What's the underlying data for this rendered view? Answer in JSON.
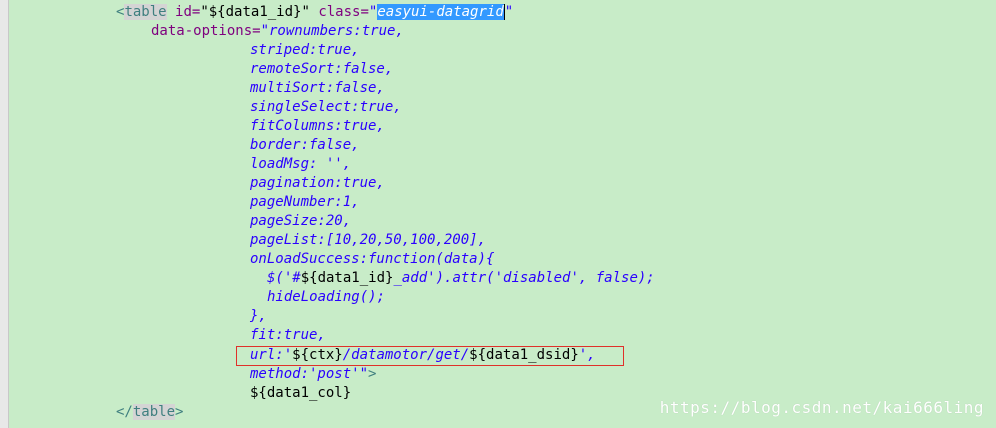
{
  "editor": {
    "line1": {
      "open": "<",
      "tag": "table",
      "attr1": " id=",
      "val1": "\"${data1_id}\"",
      "attr2": " class=",
      "quote_open": "\"",
      "selected": "easyui-datagrid",
      "quote_close": "\""
    },
    "line2": {
      "attr": "data-options=",
      "val": "\"rownumbers:true,"
    },
    "options": [
      "striped:true,",
      "remoteSort:false,",
      "multiSort:false,",
      "singleSelect:true,",
      "fitColumns:true,",
      "border:false,",
      "loadMsg: '',",
      "pagination:true,",
      "pageNumber:1,",
      "pageSize:20,",
      "pageList:[10,20,50,100,200],",
      "onLoadSuccess:function(data){"
    ],
    "inner": {
      "l1a": "$('#",
      "l1b": "${data1_id}",
      "l1c": "_add').attr('disabled', false);",
      "l2": "hideLoading();"
    },
    "close_brace": "},",
    "fit": "fit:true,",
    "url": {
      "a": "url:'",
      "b": "${ctx}",
      "c": "/datamotor/get/",
      "d": "${data1_dsid}",
      "e": "',"
    },
    "method": {
      "a": "method:'post'",
      "b": "\"",
      "c": ">"
    },
    "col": "${data1_col}",
    "closing": {
      "open": "</",
      "tag": "table",
      "close": ">"
    }
  },
  "watermark": "https://blog.csdn.net/kai666ling",
  "colors": {
    "background": "#c8ecc8",
    "highlight_box": "#e0302a",
    "selection": "#3399ff"
  }
}
